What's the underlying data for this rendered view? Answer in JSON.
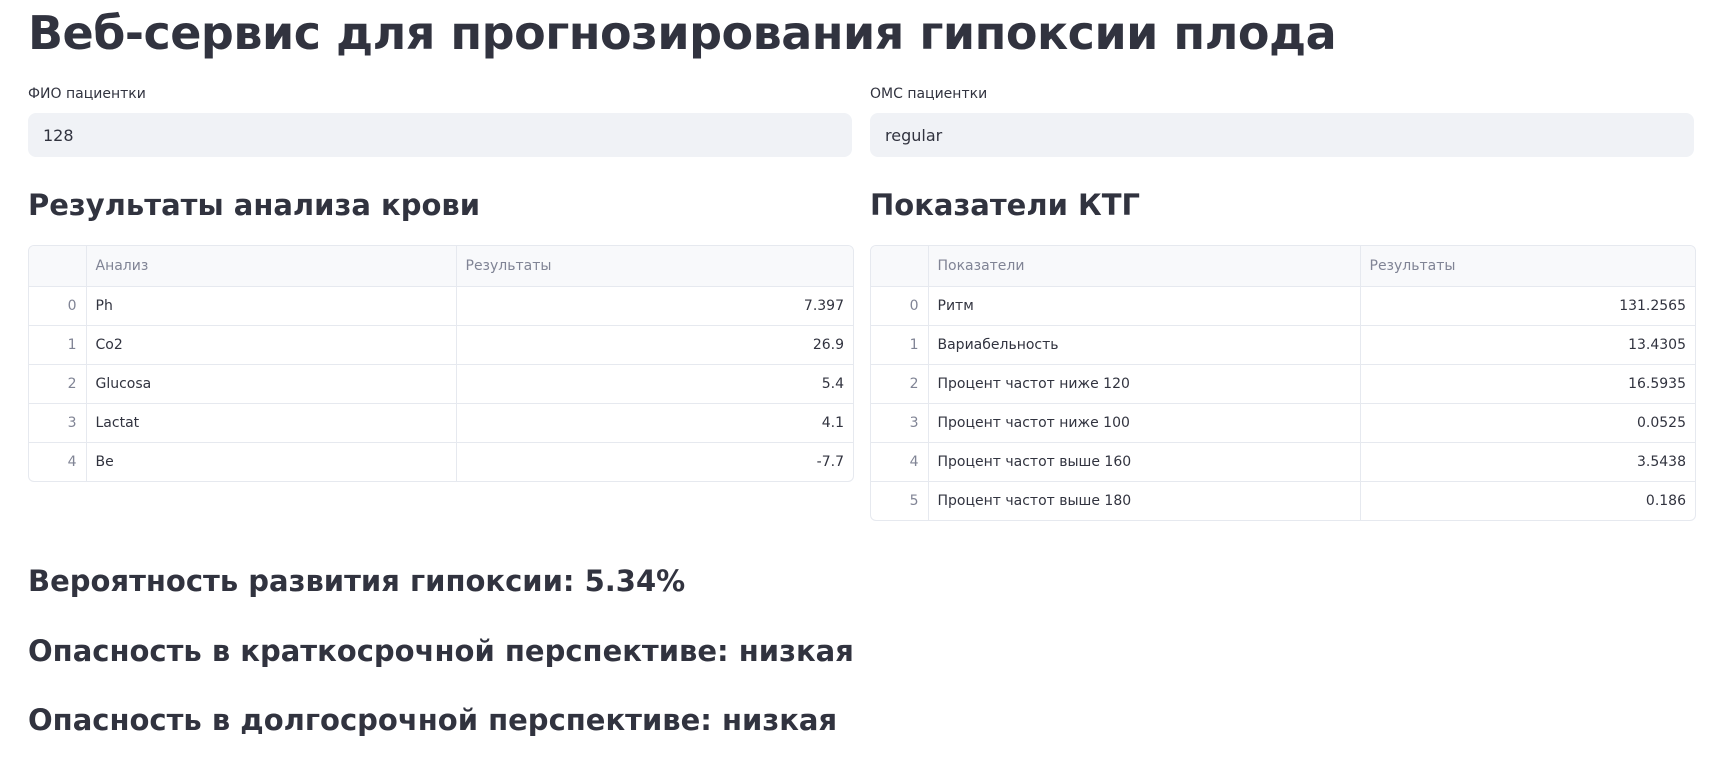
{
  "page": {
    "title": "Веб-сервис для прогнозирования гипоксии плода"
  },
  "patient": {
    "name_label": "ФИО пациентки",
    "name_value": "128",
    "oms_label": "ОМС пациентки",
    "oms_value": "regular"
  },
  "blood": {
    "heading": "Результаты анализа крови",
    "columns": [
      "",
      "Анализ",
      "Результаты"
    ],
    "rows": [
      {
        "index": "0",
        "name": "Ph",
        "value": "7.397"
      },
      {
        "index": "1",
        "name": "Co2",
        "value": "26.9"
      },
      {
        "index": "2",
        "name": "Glucosa",
        "value": "5.4"
      },
      {
        "index": "3",
        "name": "Lactat",
        "value": "4.1"
      },
      {
        "index": "4",
        "name": "Be",
        "value": "-7.7"
      }
    ]
  },
  "ktg": {
    "heading": "Показатели КТГ",
    "columns": [
      "",
      "Показатели",
      "Результаты"
    ],
    "rows": [
      {
        "index": "0",
        "name": "Ритм",
        "value": "131.2565"
      },
      {
        "index": "1",
        "name": "Вариабельность",
        "value": "13.4305"
      },
      {
        "index": "2",
        "name": "Процент частот ниже 120",
        "value": "16.5935"
      },
      {
        "index": "3",
        "name": "Процент частот ниже 100",
        "value": "0.0525"
      },
      {
        "index": "4",
        "name": "Процент частот выше 160",
        "value": "3.5438"
      },
      {
        "index": "5",
        "name": "Процент частот выше 180",
        "value": "0.186"
      }
    ]
  },
  "results": {
    "probability": "Вероятность развития гипоксии: 5.34%",
    "short_term": "Опасность в краткосрочной перспективе: низкая",
    "long_term": "Опасность в долгосрочной перспективе: низкая"
  }
}
